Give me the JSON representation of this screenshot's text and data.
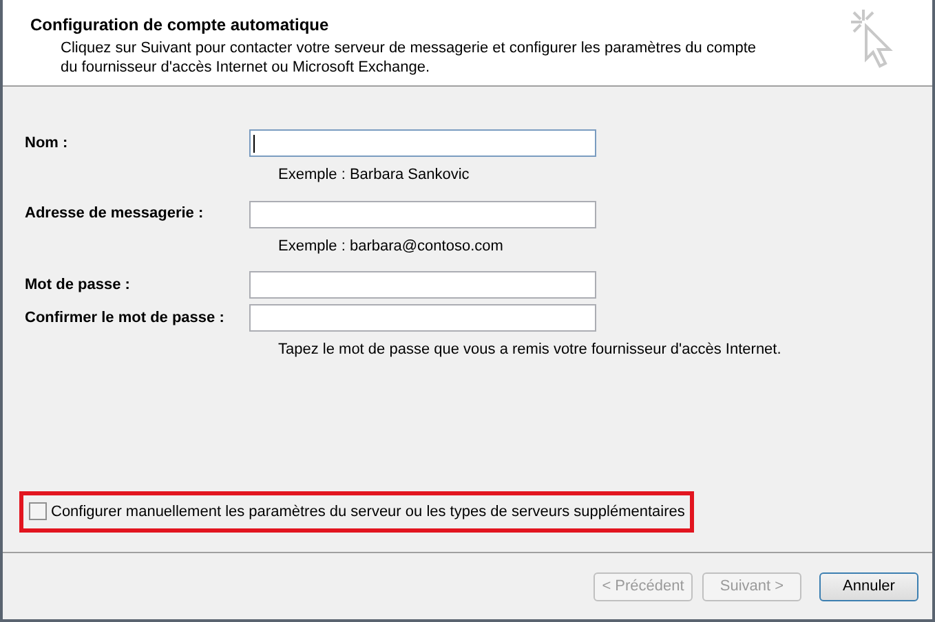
{
  "header": {
    "title": "Configuration de compte automatique",
    "description": "Cliquez sur Suivant pour contacter votre serveur de messagerie et configurer les paramètres du compte du fournisseur d'accès Internet ou Microsoft Exchange."
  },
  "fields": [
    {
      "label": "Nom :",
      "focused": true,
      "hint": "Exemple : Barbara Sankovic"
    },
    {
      "label": "Adresse de messagerie :",
      "focused": false,
      "hint": "Exemple : barbara@contoso.com"
    },
    {
      "label": "Mot de passe :",
      "focused": false
    },
    {
      "label": "Confirmer le mot de passe :",
      "focused": false,
      "hint": "Tapez le mot de passe que vous a remis votre fournisseur d'accès Internet."
    }
  ],
  "manual_config": {
    "label": "Configurer manuellement les paramètres du serveur ou les types de serveurs supplémentaires",
    "checked": false,
    "highlighted": true
  },
  "buttons": [
    {
      "label": "< Précédent",
      "disabled": true,
      "default": false
    },
    {
      "label": "Suivant >",
      "disabled": true,
      "default": false
    },
    {
      "label": "Annuler",
      "disabled": false,
      "default": true
    }
  ]
}
